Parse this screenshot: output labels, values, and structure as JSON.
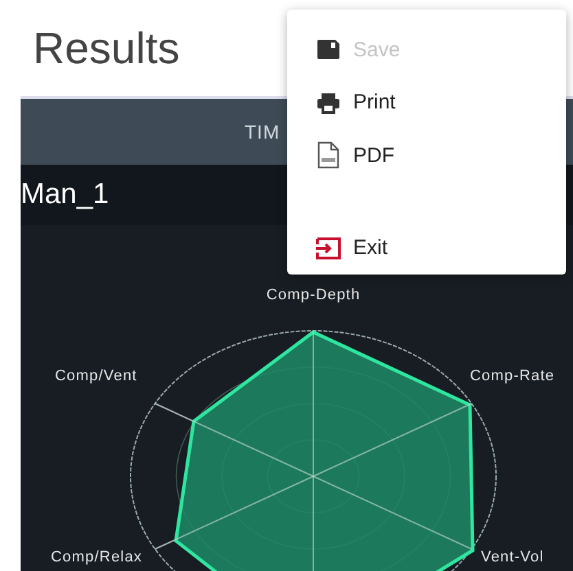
{
  "header": {
    "title": "Results"
  },
  "table": {
    "column_header": "TIM",
    "row_label": "Man_1"
  },
  "radar_chart": {
    "axis_labels": [
      "Comp-Depth",
      "Comp/Vent",
      "Comp-Rate",
      "Comp/Relax",
      "Vent-Vol"
    ]
  },
  "menu": {
    "items": [
      {
        "kind": "save",
        "label": "Save",
        "disabled": true
      },
      {
        "kind": "print",
        "label": "Print",
        "disabled": false
      },
      {
        "kind": "pdf",
        "label": "PDF",
        "disabled": false
      },
      {
        "kind": "exit",
        "label": "Exit",
        "disabled": false
      }
    ]
  }
}
